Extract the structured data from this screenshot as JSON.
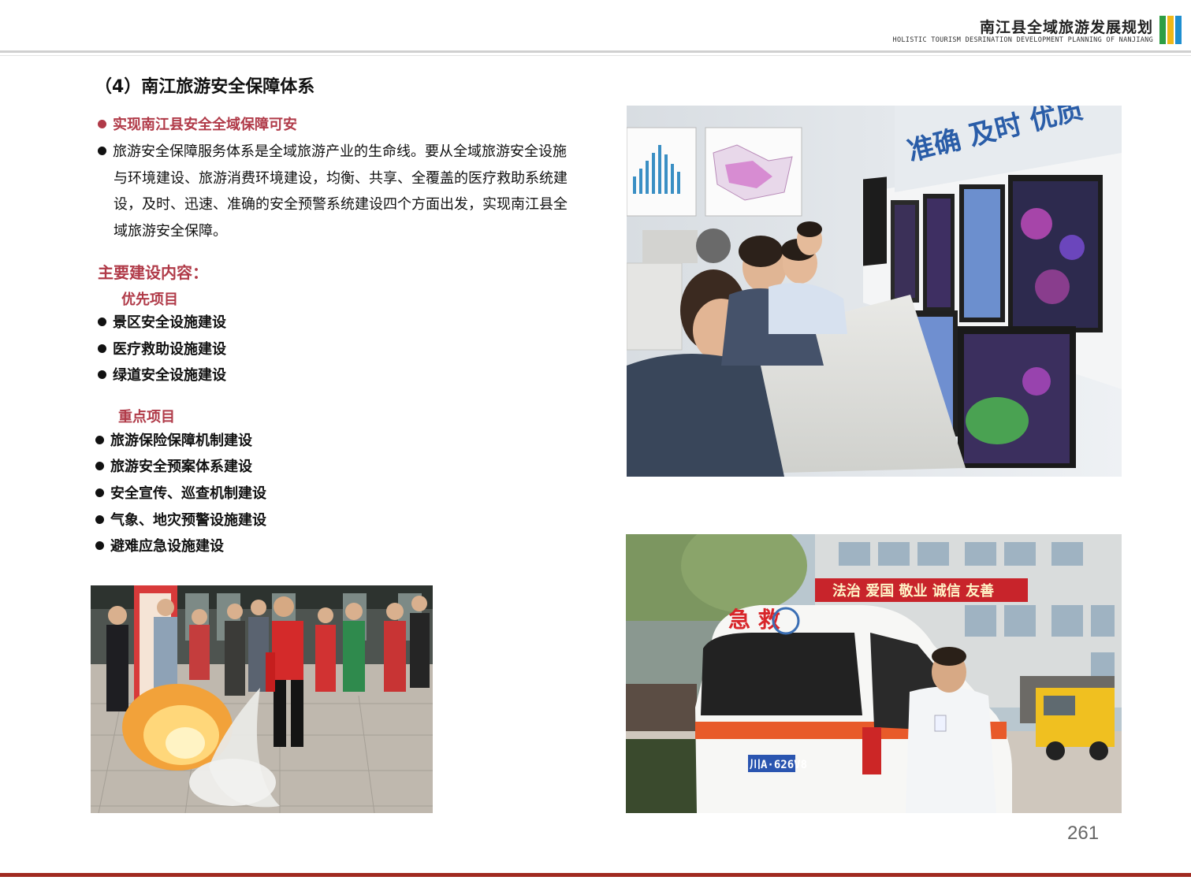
{
  "header": {
    "title": "南江县全域旅游发展规划",
    "subtitle": "HOLISTIC TOURISM DESRINATION DEVELOPMENT PLANNING OF NANJIANG",
    "logo_colors": [
      "#2e9e44",
      "#f0b818",
      "#1f8fd0"
    ]
  },
  "section": {
    "title": "（4）南江旅游安全保障体系",
    "highlight": "实现南江县安全全域保障可安",
    "paragraph_lines": [
      "旅游安全保障服务体系是全域旅游产业的生命线。要从全域旅游安全设施",
      "与环境建设、旅游消费环境建设，均衡、共享、全覆盖的医疗救助系统建",
      "设，及时、迅速、准确的安全预警系统建设四个方面出发，实现南江县全",
      "域旅游安全保障。"
    ]
  },
  "main_content": {
    "heading": "主要建设内容：",
    "priority": {
      "label": "优先项目",
      "items": [
        "景区安全设施建设",
        "医疗救助设施建设",
        "绿道安全设施建设"
      ]
    },
    "key": {
      "label": "重点项目",
      "items": [
        "旅游保险保障机制建设",
        "旅游安全预案体系建设",
        "安全宣传、巡查机制建设",
        "气象、地灾预警设施建设",
        "避难应急设施建设"
      ]
    }
  },
  "photos": {
    "control_room": {
      "wall_text": "准确 及时 优质"
    },
    "ambulance": {
      "banner_text": "法治 爱国 敬业 诚信 友善",
      "vehicle_text": "急 救",
      "plate": "川A·626V8"
    }
  },
  "page_number": "261",
  "colors": {
    "accent_red": "#b03a48",
    "footer_red": "#a02a20"
  }
}
